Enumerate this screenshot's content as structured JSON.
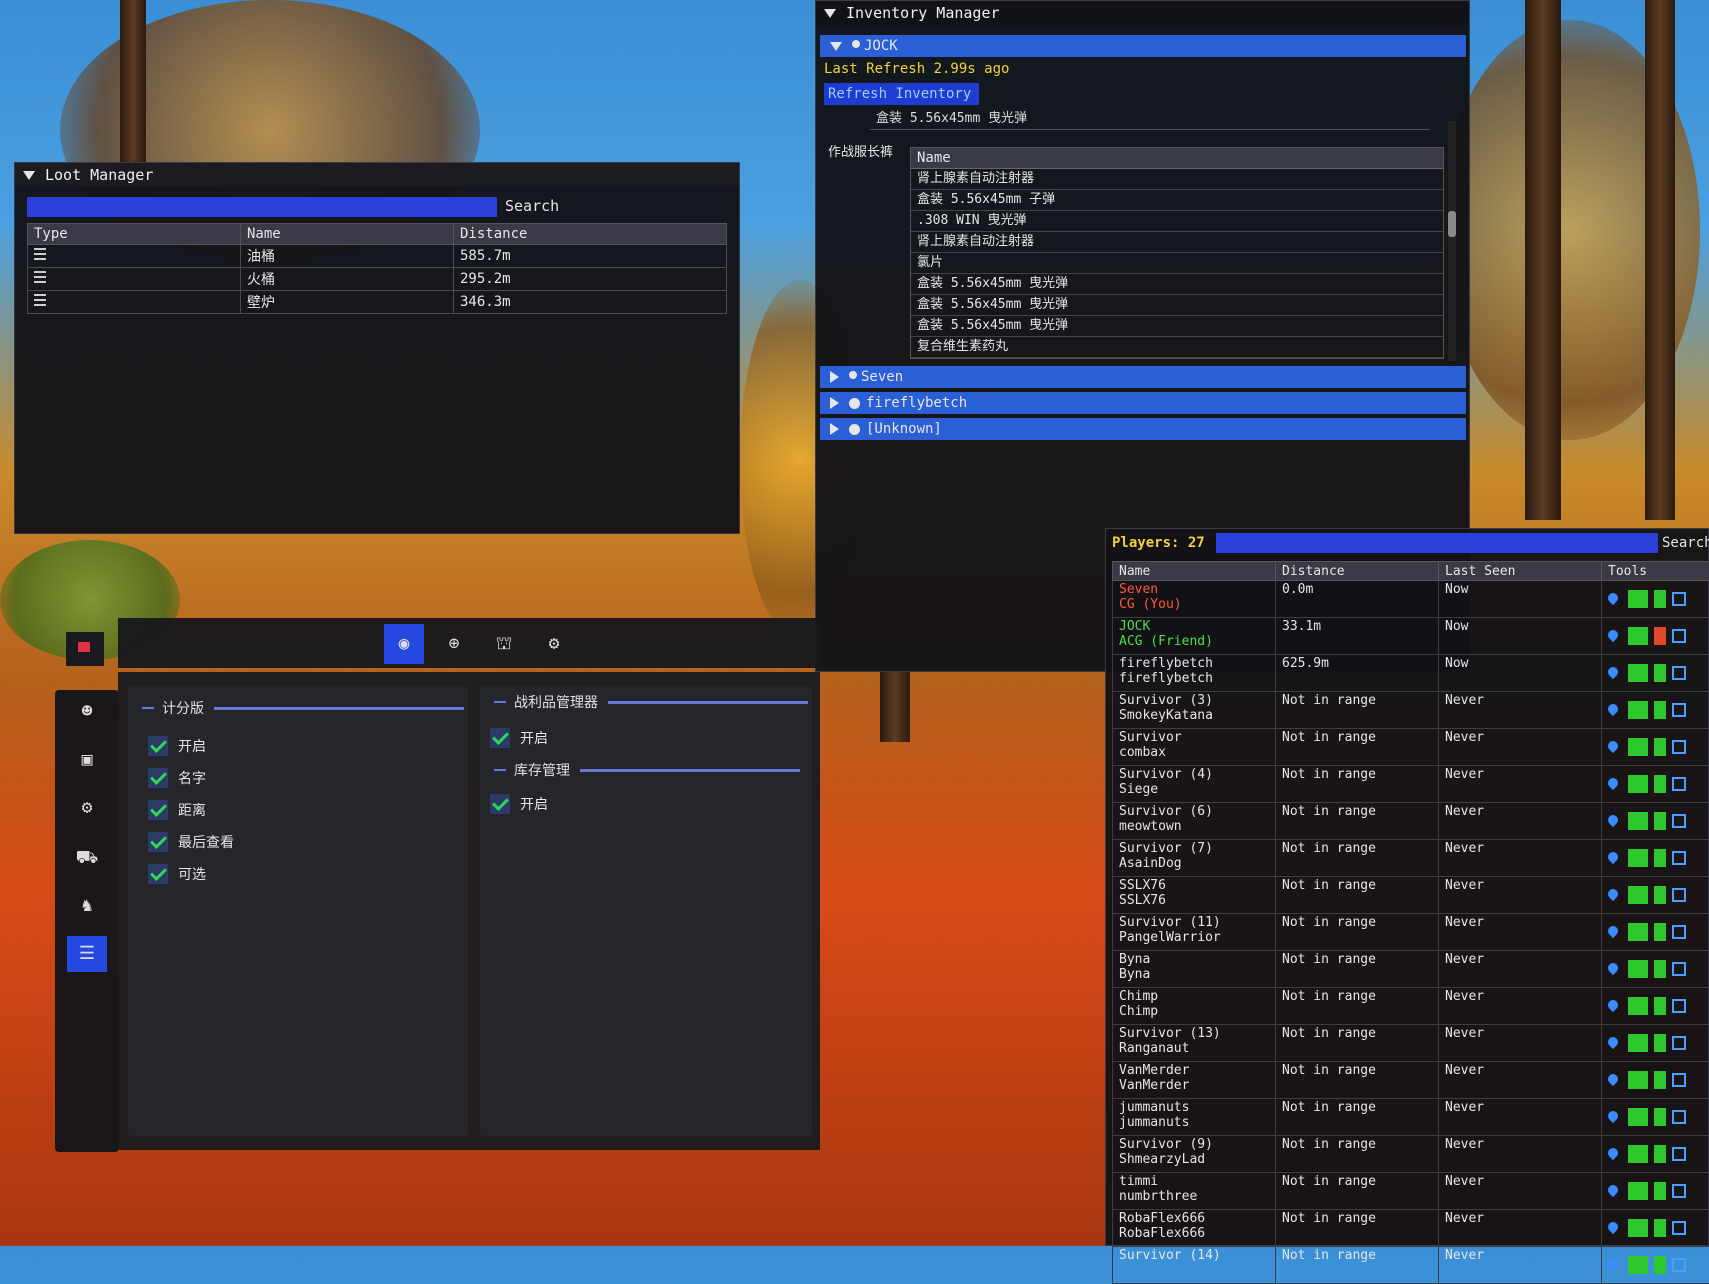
{
  "loot_manager": {
    "title": "Loot Manager",
    "search_label": "Search",
    "columns": [
      "Type",
      "Name",
      "Distance"
    ],
    "rows": [
      {
        "name": "油桶",
        "distance": "585.7m"
      },
      {
        "name": "火桶",
        "distance": "295.2m"
      },
      {
        "name": "壁炉",
        "distance": "346.3m"
      }
    ]
  },
  "inventory_manager": {
    "title": "Inventory Manager",
    "expanded_player": "JOCK",
    "last_refresh": "Last Refresh 2.99s ago",
    "refresh_button": "Refresh Inventory",
    "partial_rows": [
      "盒装 5.56x45mm 曳光弹"
    ],
    "category": "作战服长裤",
    "item_column": "Name",
    "items": [
      "肾上腺素自动注射器",
      "盒装 5.56x45mm 子弹",
      ".308 WIN 曳光弹",
      "肾上腺素自动注射器",
      "氯片",
      "盒装 5.56x45mm 曳光弹",
      "盒装 5.56x45mm 曳光弹",
      "盒装 5.56x45mm 曳光弹",
      "复合维生素药丸"
    ],
    "collapsed_players": [
      "Seven",
      "fireflybetch",
      "[Unknown]"
    ]
  },
  "players": {
    "count_label": "Players: 27",
    "search_label": "Search",
    "columns": [
      "Name",
      "Distance",
      "Last Seen",
      "Tools"
    ],
    "rows": [
      {
        "name1": "Seven",
        "name2": "CG (You)",
        "distance": "0.0m",
        "last_seen": "Now",
        "color": "#ff5a3a"
      },
      {
        "name1": "JOCK",
        "name2": "ACG (Friend)",
        "distance": "33.1m",
        "last_seen": "Now",
        "color": "#4ae04a"
      },
      {
        "name1": "fireflybetch",
        "name2": "fireflybetch",
        "distance": "625.9m",
        "last_seen": "Now",
        "color": "#e6e6e6"
      },
      {
        "name1": "Survivor (3)",
        "name2": "SmokeyKatana",
        "distance": "Not in range",
        "last_seen": "Never",
        "color": "#e6e6e6"
      },
      {
        "name1": "Survivor",
        "name2": "combax",
        "distance": "Not in range",
        "last_seen": "Never",
        "color": "#e6e6e6"
      },
      {
        "name1": "Survivor (4)",
        "name2": "Siege",
        "distance": "Not in range",
        "last_seen": "Never",
        "color": "#e6e6e6"
      },
      {
        "name1": "Survivor (6)",
        "name2": "meowtown",
        "distance": "Not in range",
        "last_seen": "Never",
        "color": "#e6e6e6"
      },
      {
        "name1": "Survivor (7)",
        "name2": "AsainDog",
        "distance": "Not in range",
        "last_seen": "Never",
        "color": "#e6e6e6"
      },
      {
        "name1": "SSLX76",
        "name2": "SSLX76",
        "distance": "Not in range",
        "last_seen": "Never",
        "color": "#e6e6e6"
      },
      {
        "name1": "Survivor (11)",
        "name2": "PangelWarrior",
        "distance": "Not in range",
        "last_seen": "Never",
        "color": "#e6e6e6"
      },
      {
        "name1": "Byna",
        "name2": "Byna",
        "distance": "Not in range",
        "last_seen": "Never",
        "color": "#e6e6e6"
      },
      {
        "name1": "Chimp",
        "name2": "Chimp",
        "distance": "Not in range",
        "last_seen": "Never",
        "color": "#e6e6e6"
      },
      {
        "name1": "Survivor (13)",
        "name2": "Ranganaut",
        "distance": "Not in range",
        "last_seen": "Never",
        "color": "#e6e6e6"
      },
      {
        "name1": "VanMerder",
        "name2": "VanMerder",
        "distance": "Not in range",
        "last_seen": "Never",
        "color": "#e6e6e6"
      },
      {
        "name1": "jummanuts",
        "name2": "jummanuts",
        "distance": "Not in range",
        "last_seen": "Never",
        "color": "#e6e6e6"
      },
      {
        "name1": "Survivor (9)",
        "name2": "ShmearzyLad",
        "distance": "Not in range",
        "last_seen": "Never",
        "color": "#e6e6e6"
      },
      {
        "name1": "timmi",
        "name2": "numbrthree",
        "distance": "Not in range",
        "last_seen": "Never",
        "color": "#e6e6e6"
      },
      {
        "name1": "RobaFlex666",
        "name2": "RobaFlex666",
        "distance": "Not in range",
        "last_seen": "Never",
        "color": "#e6e6e6"
      },
      {
        "name1": "Survivor (14)",
        "name2": "",
        "distance": "Not in range",
        "last_seen": "Never",
        "color": "#e6e6e6"
      }
    ]
  },
  "settings": {
    "score_section": {
      "title": "计分版",
      "options": [
        "开启",
        "名字",
        "距离",
        "最后查看",
        "可选"
      ]
    },
    "loot_section": {
      "title": "战利品管理器",
      "options": [
        "开启"
      ]
    },
    "inventory_section": {
      "title": "库存管理",
      "options": [
        "开启"
      ]
    }
  }
}
